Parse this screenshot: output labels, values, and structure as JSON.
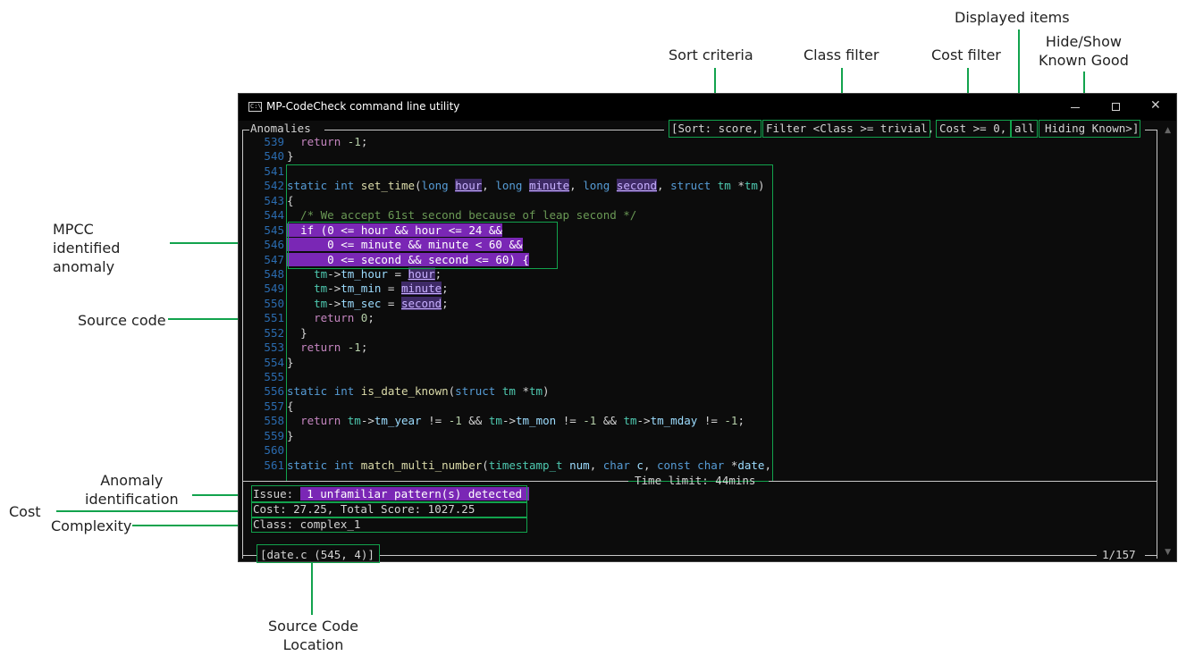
{
  "annotations": {
    "sort_criteria": "Sort criteria",
    "class_filter": "Class filter",
    "cost_filter": "Cost filter",
    "displayed_items": "Displayed items",
    "hide_show_line1": "Hide/Show",
    "hide_show_line2": "Known Good",
    "mpcc_line1": "MPCC",
    "mpcc_line2": "identified",
    "mpcc_line3": "anomaly",
    "source_code": "Source code",
    "anomaly_id_line1": "Anomaly",
    "anomaly_id_line2": "identification",
    "cost": "Cost",
    "complexity": "Complexity",
    "source_loc_line1": "Source Code",
    "source_loc_line2": "Location"
  },
  "window": {
    "title": "MP-CodeCheck command line utility",
    "minimize_icon": "minimize-icon",
    "maximize_icon": "maximize-icon",
    "close_icon": "close-icon"
  },
  "panel": {
    "title": "Anomalies",
    "sort": "[Sort: score,",
    "class_filter": "Filter <Class >= trivial,",
    "cost_filter": "Cost >= 0,",
    "displayed": "all",
    "known": "Hiding Known>]",
    "time_limit": "Time limit: 44mins",
    "location": "[date.c (545, 4)]",
    "page": "1/157"
  },
  "issue": {
    "label": "Issue:",
    "value": "1 unfamiliar pattern(s) detected",
    "cost_line": "Cost: 27.25, Total Score: 1027.25",
    "class_line": "Class: complex_1"
  },
  "code_lines": [
    {
      "n": "539",
      "t": "  return -1;"
    },
    {
      "n": "540",
      "t": "}"
    },
    {
      "n": "541",
      "t": ""
    },
    {
      "n": "542",
      "t": "static int set_time(long hour, long minute, long second, struct tm *tm)"
    },
    {
      "n": "543",
      "t": "{"
    },
    {
      "n": "544",
      "t": "  /* We accept 61st second because of leap second */"
    },
    {
      "n": "545",
      "t": "  if (0 <= hour && hour <= 24 &&"
    },
    {
      "n": "546",
      "t": "      0 <= minute && minute < 60 &&"
    },
    {
      "n": "547",
      "t": "      0 <= second && second <= 60) {"
    },
    {
      "n": "548",
      "t": "    tm->tm_hour = hour;"
    },
    {
      "n": "549",
      "t": "    tm->tm_min = minute;"
    },
    {
      "n": "550",
      "t": "    tm->tm_sec = second;"
    },
    {
      "n": "551",
      "t": "    return 0;"
    },
    {
      "n": "552",
      "t": "  }"
    },
    {
      "n": "553",
      "t": "  return -1;"
    },
    {
      "n": "554",
      "t": "}"
    },
    {
      "n": "555",
      "t": ""
    },
    {
      "n": "556",
      "t": "static int is_date_known(struct tm *tm)"
    },
    {
      "n": "557",
      "t": "{"
    },
    {
      "n": "558",
      "t": "  return tm->tm_year != -1 && tm->tm_mon != -1 && tm->tm_mday != -1;"
    },
    {
      "n": "559",
      "t": "}"
    },
    {
      "n": "560",
      "t": ""
    },
    {
      "n": "561",
      "t": "static int match_multi_number(timestamp_t num, char c, const char *date,"
    }
  ],
  "colors": {
    "callout_green": "#12a34d",
    "highlight_purple": "#7a27b5",
    "terminal_bg": "#0c0c0c"
  }
}
